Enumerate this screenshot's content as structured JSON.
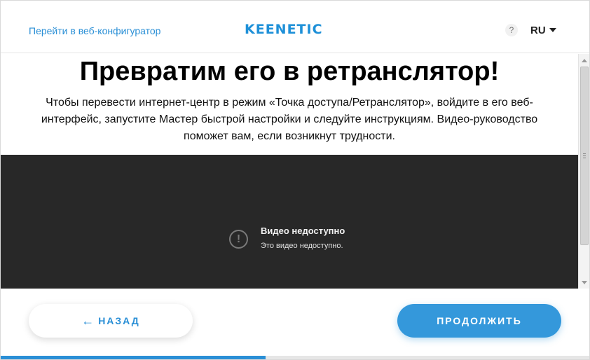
{
  "header": {
    "web_link": "Перейти в веб-конфигуратор",
    "logo": "KEENETIC",
    "help": "?",
    "lang": "RU"
  },
  "main": {
    "title": "Превратим его в ретранслятор!",
    "description": "Чтобы перевести интернет-центр в режим «Точка доступа/Ретранслятор», войдите в его веб-интерфейс, запустите Мастер быстрой настройки и следуйте инструкциям. Видео-руководство поможет вам, если возникнут трудности.",
    "video": {
      "icon": "!",
      "title": "Видео недоступно",
      "subtitle": "Это видео недоступно."
    }
  },
  "footer": {
    "back_icon": "←",
    "back_label": "НАЗАД",
    "next_label": "ПРОДОЛЖИТЬ"
  },
  "progress": {
    "value": 0.45
  },
  "colors": {
    "accent": "#2a8fd6",
    "button": "#3498db",
    "video_bg": "#282828"
  }
}
